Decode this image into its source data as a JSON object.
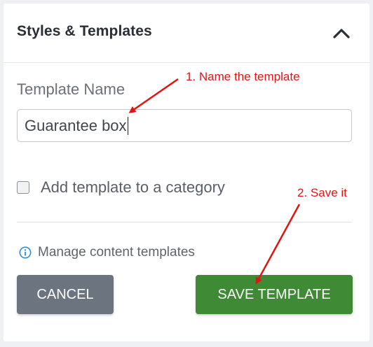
{
  "panel": {
    "title": "Styles & Templates",
    "collapse_icon": "chevron-up-icon"
  },
  "form": {
    "template_name_label": "Template Name",
    "template_name_value": "Guarantee box",
    "category_checkbox_label": "Add template to a category",
    "category_checkbox_checked": false,
    "manage_link_icon": "info-icon",
    "manage_link_label": "Manage content templates"
  },
  "buttons": {
    "cancel_label": "CANCEL",
    "save_label": "SAVE TEMPLATE"
  },
  "annotations": {
    "step1": "1. Name the template",
    "step2": "2. Save it"
  },
  "colors": {
    "save_button": "#3f8a35",
    "cancel_button": "#6c7480",
    "annotation": "#e01414",
    "info_icon": "#2b8fd6"
  }
}
